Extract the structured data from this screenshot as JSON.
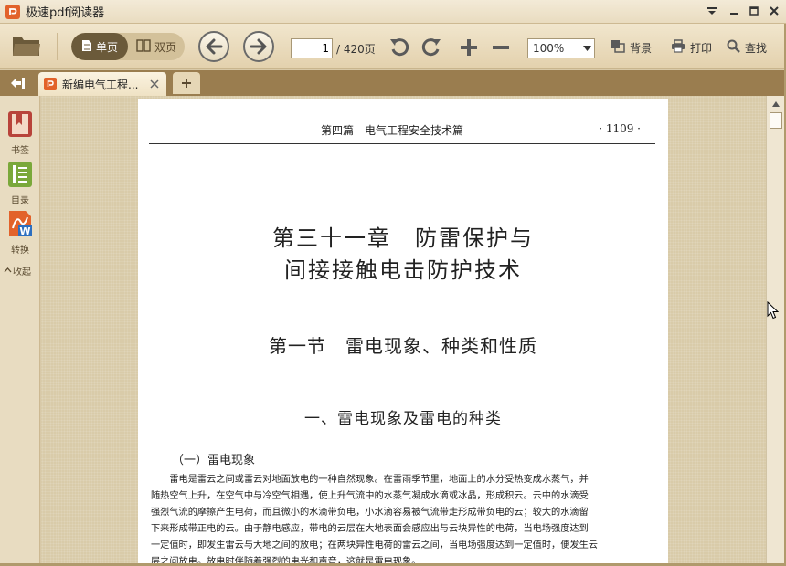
{
  "app": {
    "title": "极速pdf阅读器"
  },
  "toolbar": {
    "single_page_label": "单页",
    "double_page_label": "双页",
    "current_page": "1",
    "total_pages": "/ 420页",
    "zoom": "100%",
    "background_label": "背景",
    "print_label": "打印",
    "search_label": "查找"
  },
  "tabs": [
    {
      "label": "新编电气工程..."
    }
  ],
  "sidebar": {
    "bookmarks_label": "书签",
    "toc_label": "目录",
    "convert_label": "转换",
    "collapse_label": "收起"
  },
  "document": {
    "running_header": "第四篇　电气工程安全技术篇",
    "page_number": "· 1109 ·",
    "chapter_line1": "第三十一章　防雷保护与",
    "chapter_line2": "间接接触电击防护技术",
    "section_title": "第一节　雷电现象、种类和性质",
    "subsection_title": "一、雷电现象及雷电的种类",
    "subsubsection_title": "（一）雷电现象",
    "paragraph_lines": [
      "　　雷电是雷云之间或雷云对地面放电的一种自然现象。在雷雨季节里，地面上的水分受热变成水蒸气，并",
      "随热空气上升，在空气中与冷空气相遇，使上升气流中的水蒸气凝成水滴或冰晶，形成积云。云中的水滴受",
      "强烈气流的摩擦产生电荷，而且微小的水滴带负电，小水滴容易被气流带走形成带负电的云；较大的水滴留",
      "下来形成带正电的云。由于静电感应，带电的云层在大地表面会感应出与云块异性的电荷，当电场强度达到",
      "一定值时，即发生雷云与大地之间的放电；在两块异性电荷的雷云之间，当电场强度达到一定值时，便发生云",
      "层之间放电。放电时伴随着强烈的电光和声音，这就是雷电现象。"
    ]
  },
  "colors": {
    "accent": "#e2622a",
    "toolbar_bg": "#e9dcc0",
    "tabbar_bg": "#9a7d4f",
    "viewer_bg": "#d9cba9"
  }
}
